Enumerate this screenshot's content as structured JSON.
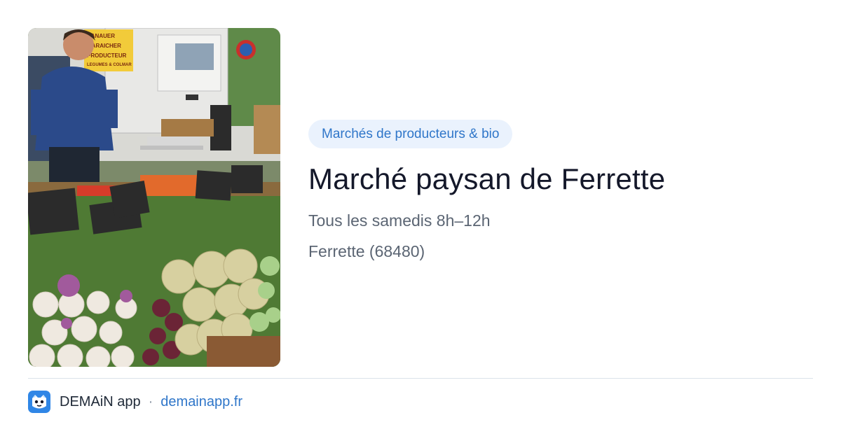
{
  "card": {
    "image_alt": "Marché paysan de Ferrette",
    "photo_sign_text": [
      "HANAUER",
      "MARAICHER",
      "PRODUCTEUR",
      "LEGUMES & COLMAR"
    ],
    "category_tag": "Marchés de producteurs & bio",
    "title": "Marché paysan de Ferrette",
    "schedule": "Tous les samedis 8h–12h",
    "location": "Ferrette (68480)"
  },
  "footer": {
    "app_name": "DEMAiN app",
    "separator": "·",
    "domain": "demainapp.fr"
  },
  "colors": {
    "accent": "#2f76c9",
    "tag_background": "#eaf2fd",
    "logo_background": "#2f86e6",
    "divider": "#dbe3ea"
  },
  "icons": {
    "app_logo": "demain-app-logo-icon"
  }
}
